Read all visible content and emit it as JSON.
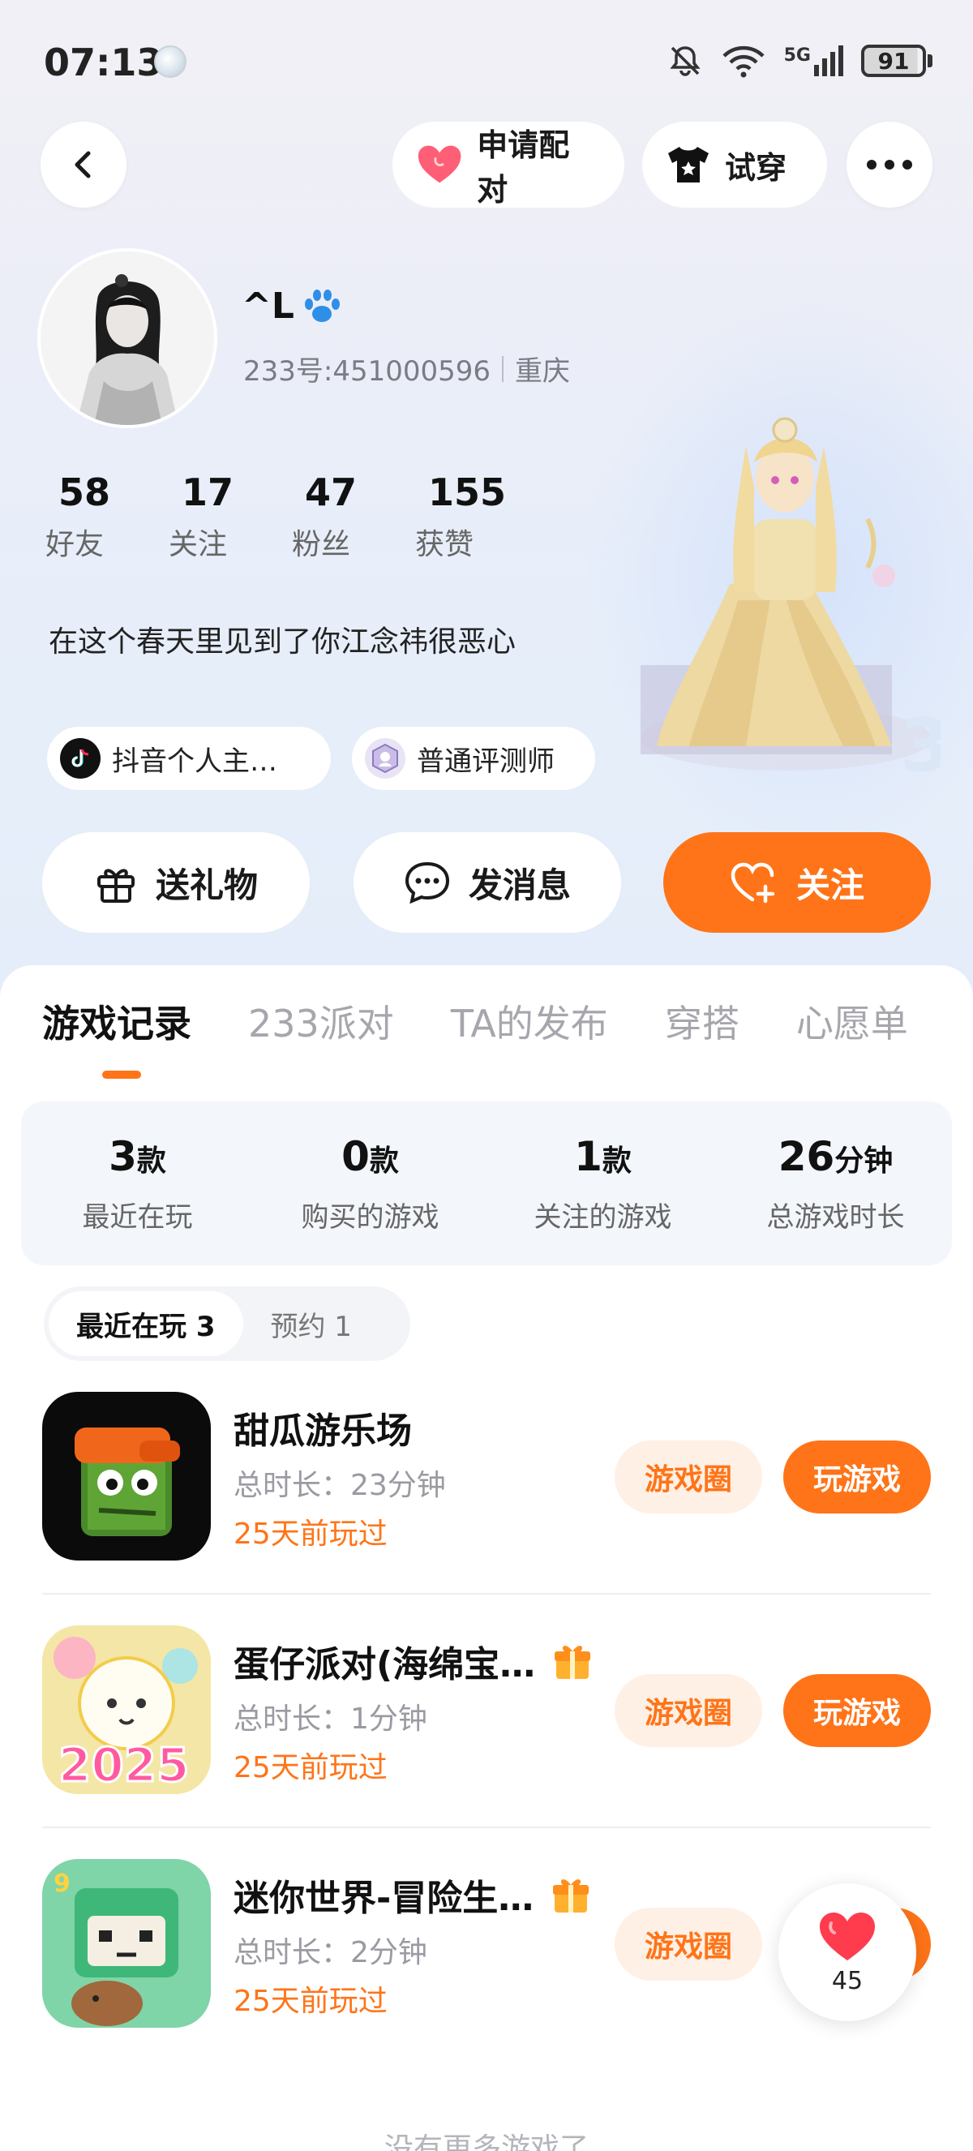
{
  "status_bar": {
    "time": "07:13",
    "network": "5G",
    "battery": "91"
  },
  "header": {
    "pair_label": "申请配对",
    "try_label": "试穿"
  },
  "profile": {
    "username": "^L",
    "id_text": "233号:451000596",
    "location": "重庆",
    "stats": [
      {
        "value": "58",
        "label": "好友"
      },
      {
        "value": "17",
        "label": "关注"
      },
      {
        "value": "47",
        "label": "粉丝"
      },
      {
        "value": "155",
        "label": "获赞"
      }
    ],
    "bio": "在这个春天里见到了你江念祎很恶心",
    "tags": [
      {
        "label": "抖音个人主…"
      },
      {
        "label": "普通评测师"
      }
    ]
  },
  "actions": {
    "gift": "送礼物",
    "message": "发消息",
    "follow": "关注"
  },
  "tabs": [
    "游戏记录",
    "233派对",
    "TA的发布",
    "穿搭",
    "心愿单"
  ],
  "summary": [
    {
      "value": "3",
      "unit": "款",
      "label": "最近在玩"
    },
    {
      "value": "0",
      "unit": "款",
      "label": "购买的游戏"
    },
    {
      "value": "1",
      "unit": "款",
      "label": "关注的游戏"
    },
    {
      "value": "26",
      "unit": "分钟",
      "label": "总游戏时长"
    }
  ],
  "segment": {
    "recent": "最近在玩 3",
    "reserve": "预约 1"
  },
  "games": [
    {
      "name": "甜瓜游乐场",
      "duration": "总时长：23分钟",
      "last_played": "25天前玩过",
      "circle": "游戏圈",
      "play": "玩游戏",
      "gift": false
    },
    {
      "name": "蛋仔派对(海绵宝…",
      "duration": "总时长：1分钟",
      "last_played": "25天前玩过",
      "circle": "游戏圈",
      "play": "玩游戏",
      "gift": true
    },
    {
      "name": "迷你世界-冒险生…",
      "duration": "总时长：2分钟",
      "last_played": "25天前玩过",
      "circle": "游戏圈",
      "play": "玩游戏",
      "gift": true
    }
  ],
  "like_count": "45",
  "footer": {
    "no_more": "没有更多游戏了"
  },
  "colors": {
    "accent": "#ff7418",
    "accent_light": "#fff0e5",
    "heart": "#ff3b4e"
  }
}
